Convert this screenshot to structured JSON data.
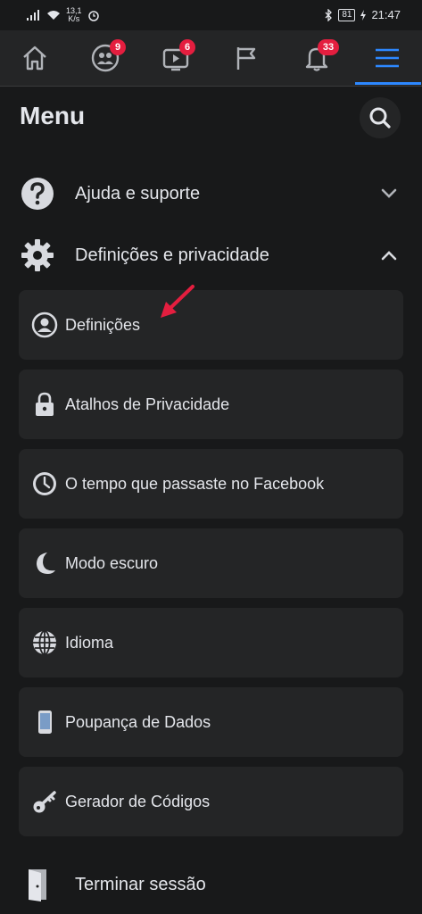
{
  "status_bar": {
    "speed_value": "13,1",
    "speed_unit": "K/s",
    "battery": "81",
    "time": "21:47"
  },
  "nav": {
    "badges": {
      "friends": "9",
      "watch": "6",
      "notifications": "33"
    },
    "icons": [
      "home-icon",
      "friends-icon",
      "watch-icon",
      "pages-flag-icon",
      "bell-icon",
      "hamburger-menu-icon"
    ]
  },
  "header": {
    "title": "Menu"
  },
  "sections": {
    "help": "Ajuda e suporte",
    "settings_privacy": "Definições e privacidade"
  },
  "items": {
    "settings": "Definições",
    "privacy_shortcuts": "Atalhos de Privacidade",
    "time_on_facebook": "O tempo que passaste no Facebook",
    "dark_mode": "Modo escuro",
    "language": "Idioma",
    "data_saver": "Poupança de Dados",
    "code_generator": "Gerador de Códigos"
  },
  "logout": "Terminar sessão",
  "colors": {
    "background": "#18191a",
    "card": "#242526",
    "accent": "#2d88ff",
    "badge": "#e41e3f",
    "annotation_arrow": "#e41e3f"
  }
}
